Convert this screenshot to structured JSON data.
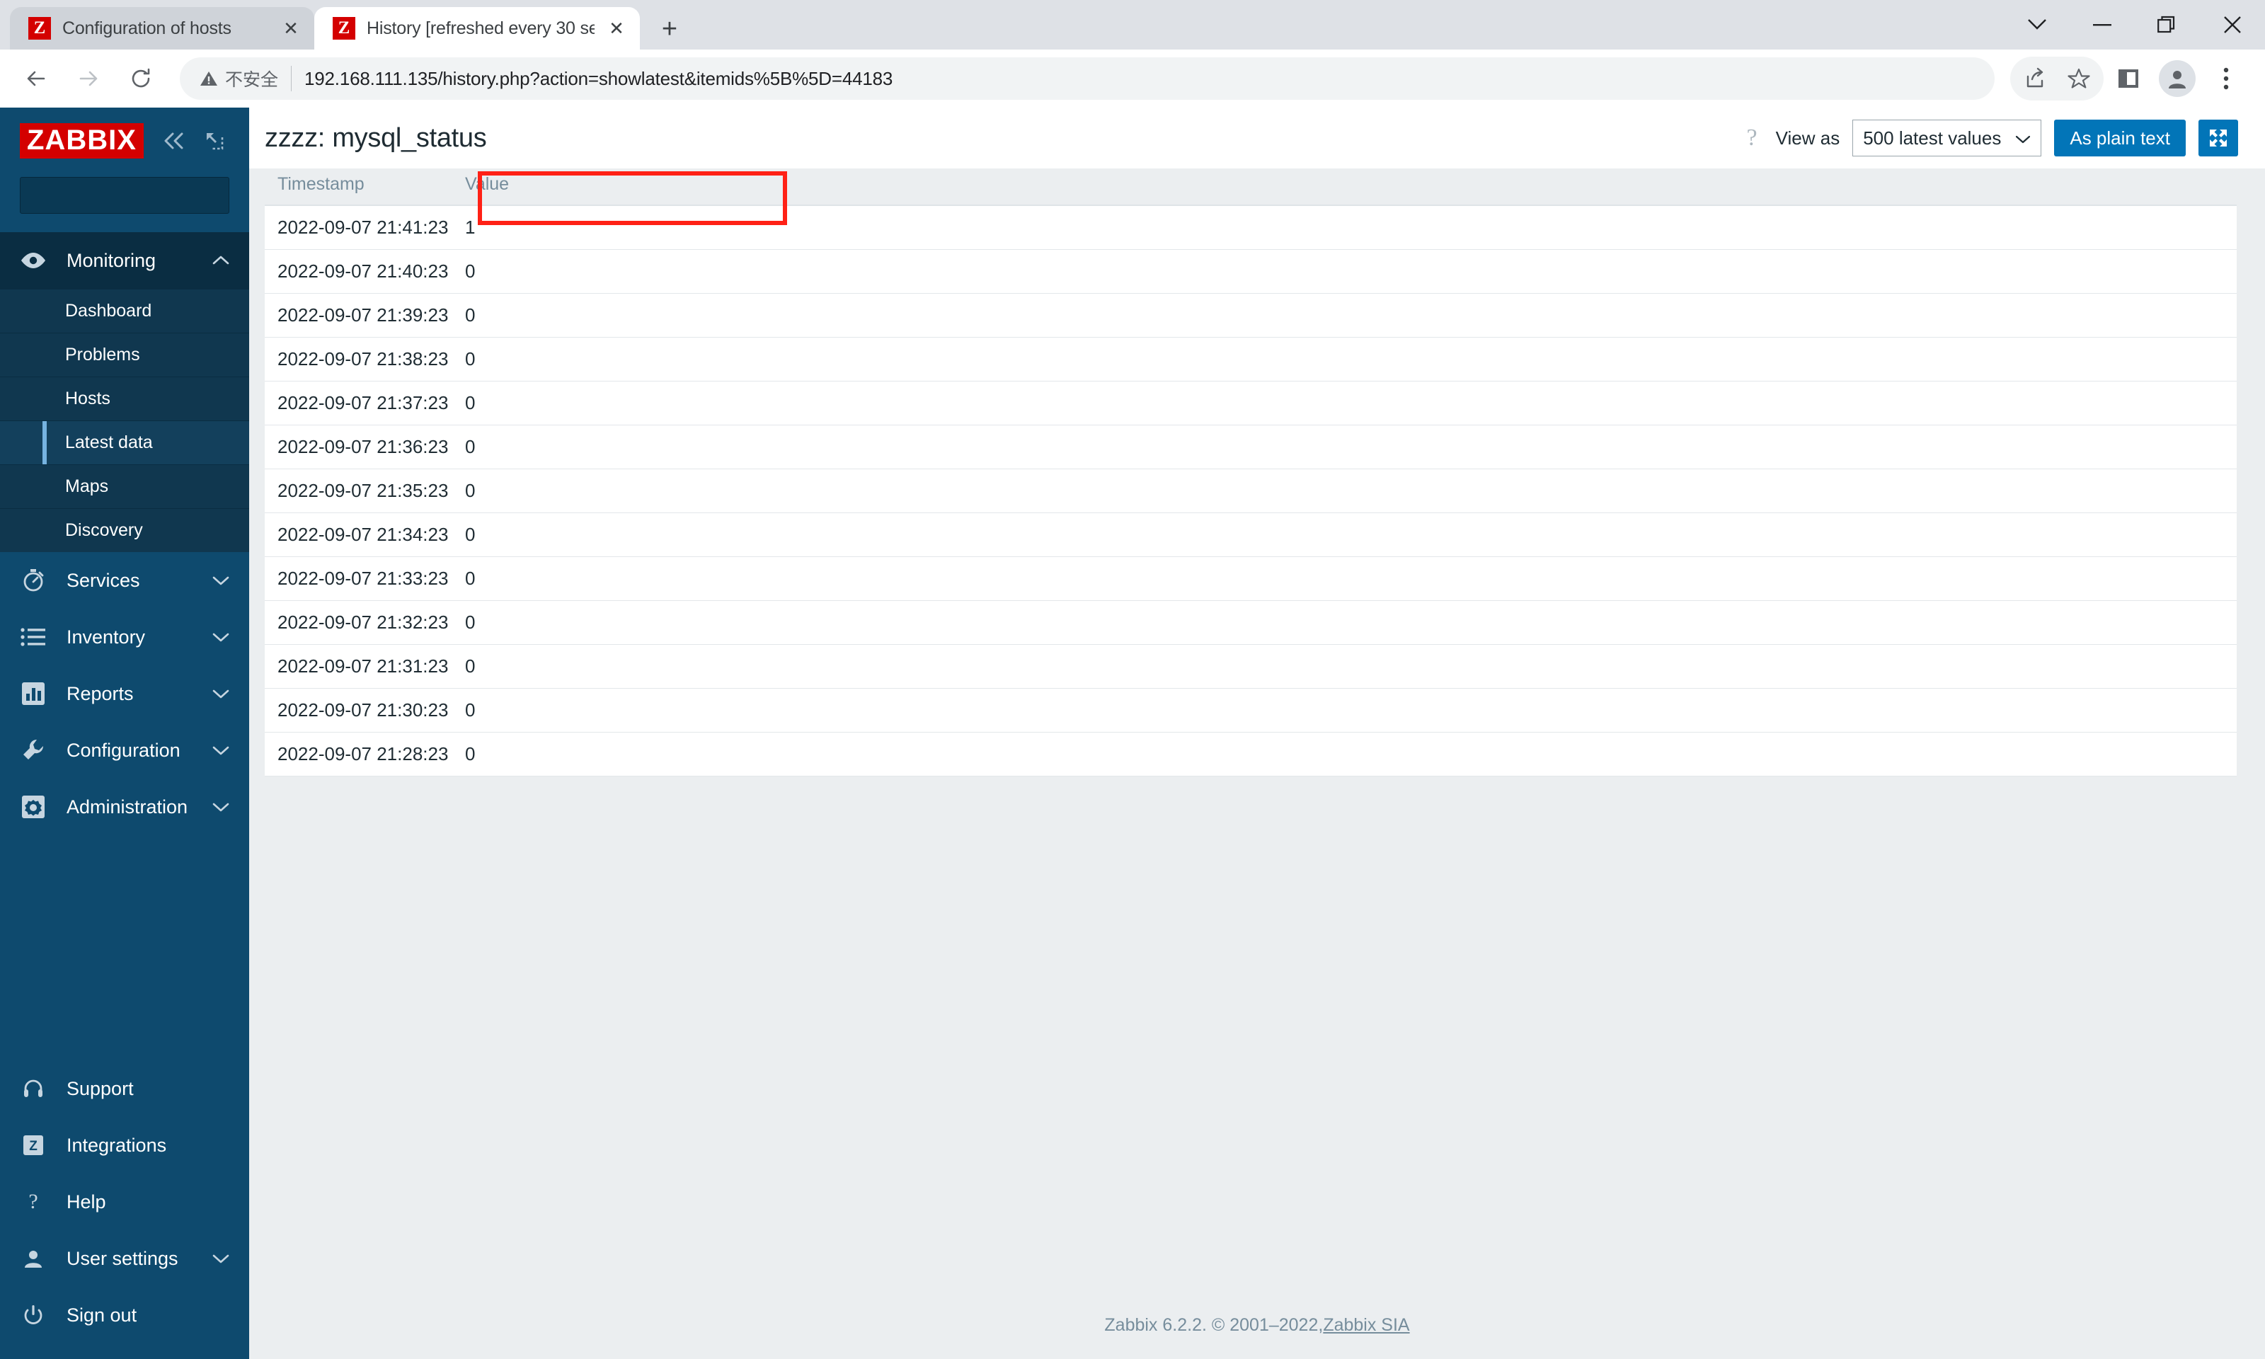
{
  "browser": {
    "tabs": [
      {
        "title": "Configuration of hosts",
        "favicon": "zabbix-favicon",
        "active": false
      },
      {
        "title": "History [refreshed every 30 se",
        "favicon": "zabbix-favicon",
        "active": true
      }
    ],
    "new_tab_label": "+",
    "close_label": "✕",
    "security_text": "不安全",
    "url_host": "192.168.111.135",
    "url_path": "/history.php?action=showlatest&itemids%5B%5D=44183",
    "window_controls": [
      "tab-search-chevron",
      "minimize",
      "restore",
      "close"
    ],
    "toolbar_icons": [
      "back-icon",
      "forward-icon",
      "reload-icon",
      "share-icon",
      "bookmark-star-icon",
      "side-panel-icon",
      "profile-avatar",
      "three-dot-menu-icon"
    ]
  },
  "sidebar": {
    "logo": "ZABBIX",
    "collapse_icon": "chevron-double-left-icon",
    "hide_icon": "collapse-sidebar-icon",
    "search": {
      "value": "",
      "placeholder": ""
    },
    "nav": [
      {
        "label": "Monitoring",
        "icon": "eye-icon",
        "expanded": true,
        "chevron": "chevron-up-icon",
        "children": [
          {
            "label": "Dashboard",
            "active": false
          },
          {
            "label": "Problems",
            "active": false
          },
          {
            "label": "Hosts",
            "active": false
          },
          {
            "label": "Latest data",
            "active": true
          },
          {
            "label": "Maps",
            "active": false
          },
          {
            "label": "Discovery",
            "active": false
          }
        ]
      },
      {
        "label": "Services",
        "icon": "stopwatch-icon",
        "expanded": false,
        "chevron": "chevron-down-icon",
        "children": []
      },
      {
        "label": "Inventory",
        "icon": "list-icon",
        "expanded": false,
        "chevron": "chevron-down-icon",
        "children": []
      },
      {
        "label": "Reports",
        "icon": "bar-chart-icon",
        "expanded": false,
        "chevron": "chevron-down-icon",
        "children": []
      },
      {
        "label": "Configuration",
        "icon": "wrench-icon",
        "expanded": false,
        "chevron": "chevron-down-icon",
        "children": []
      },
      {
        "label": "Administration",
        "icon": "gear-icon",
        "expanded": false,
        "chevron": "chevron-down-icon",
        "children": []
      }
    ],
    "footer_nav": [
      {
        "label": "Support",
        "icon": "headset-icon",
        "chevron": ""
      },
      {
        "label": "Integrations",
        "icon": "zabbix-badge-icon",
        "chevron": ""
      },
      {
        "label": "Help",
        "icon": "question-mark-icon",
        "chevron": ""
      },
      {
        "label": "User settings",
        "icon": "user-icon",
        "chevron": "chevron-down-icon"
      },
      {
        "label": "Sign out",
        "icon": "power-icon",
        "chevron": ""
      }
    ]
  },
  "header": {
    "title": "zzzz: mysql_status",
    "help_icon": "question-mark-icon",
    "view_as_label": "View as",
    "view_as_value": "500 latest values",
    "plain_text_button": "As plain text",
    "kiosk_icon": "expand-arrows-icon"
  },
  "table": {
    "columns": [
      "Timestamp",
      "Value"
    ],
    "rows": [
      {
        "timestamp": "2022-09-07 21:41:23",
        "value": "1",
        "highlighted": true
      },
      {
        "timestamp": "2022-09-07 21:40:23",
        "value": "0",
        "highlighted": false
      },
      {
        "timestamp": "2022-09-07 21:39:23",
        "value": "0",
        "highlighted": false
      },
      {
        "timestamp": "2022-09-07 21:38:23",
        "value": "0",
        "highlighted": false
      },
      {
        "timestamp": "2022-09-07 21:37:23",
        "value": "0",
        "highlighted": false
      },
      {
        "timestamp": "2022-09-07 21:36:23",
        "value": "0",
        "highlighted": false
      },
      {
        "timestamp": "2022-09-07 21:35:23",
        "value": "0",
        "highlighted": false
      },
      {
        "timestamp": "2022-09-07 21:34:23",
        "value": "0",
        "highlighted": false
      },
      {
        "timestamp": "2022-09-07 21:33:23",
        "value": "0",
        "highlighted": false
      },
      {
        "timestamp": "2022-09-07 21:32:23",
        "value": "0",
        "highlighted": false
      },
      {
        "timestamp": "2022-09-07 21:31:23",
        "value": "0",
        "highlighted": false
      },
      {
        "timestamp": "2022-09-07 21:30:23",
        "value": "0",
        "highlighted": false
      },
      {
        "timestamp": "2022-09-07 21:28:23",
        "value": "0",
        "highlighted": false
      }
    ]
  },
  "footer": {
    "text": "Zabbix 6.2.2. © 2001–2022, ",
    "link": "Zabbix SIA"
  },
  "colors": {
    "sidebar_bg": "#0e4a6e",
    "sidebar_dark": "#0a2d42",
    "accent_blue": "#0275b8",
    "brand_red": "#d40000",
    "annotation_red": "#ff2116",
    "page_bg": "#ebeef0"
  }
}
